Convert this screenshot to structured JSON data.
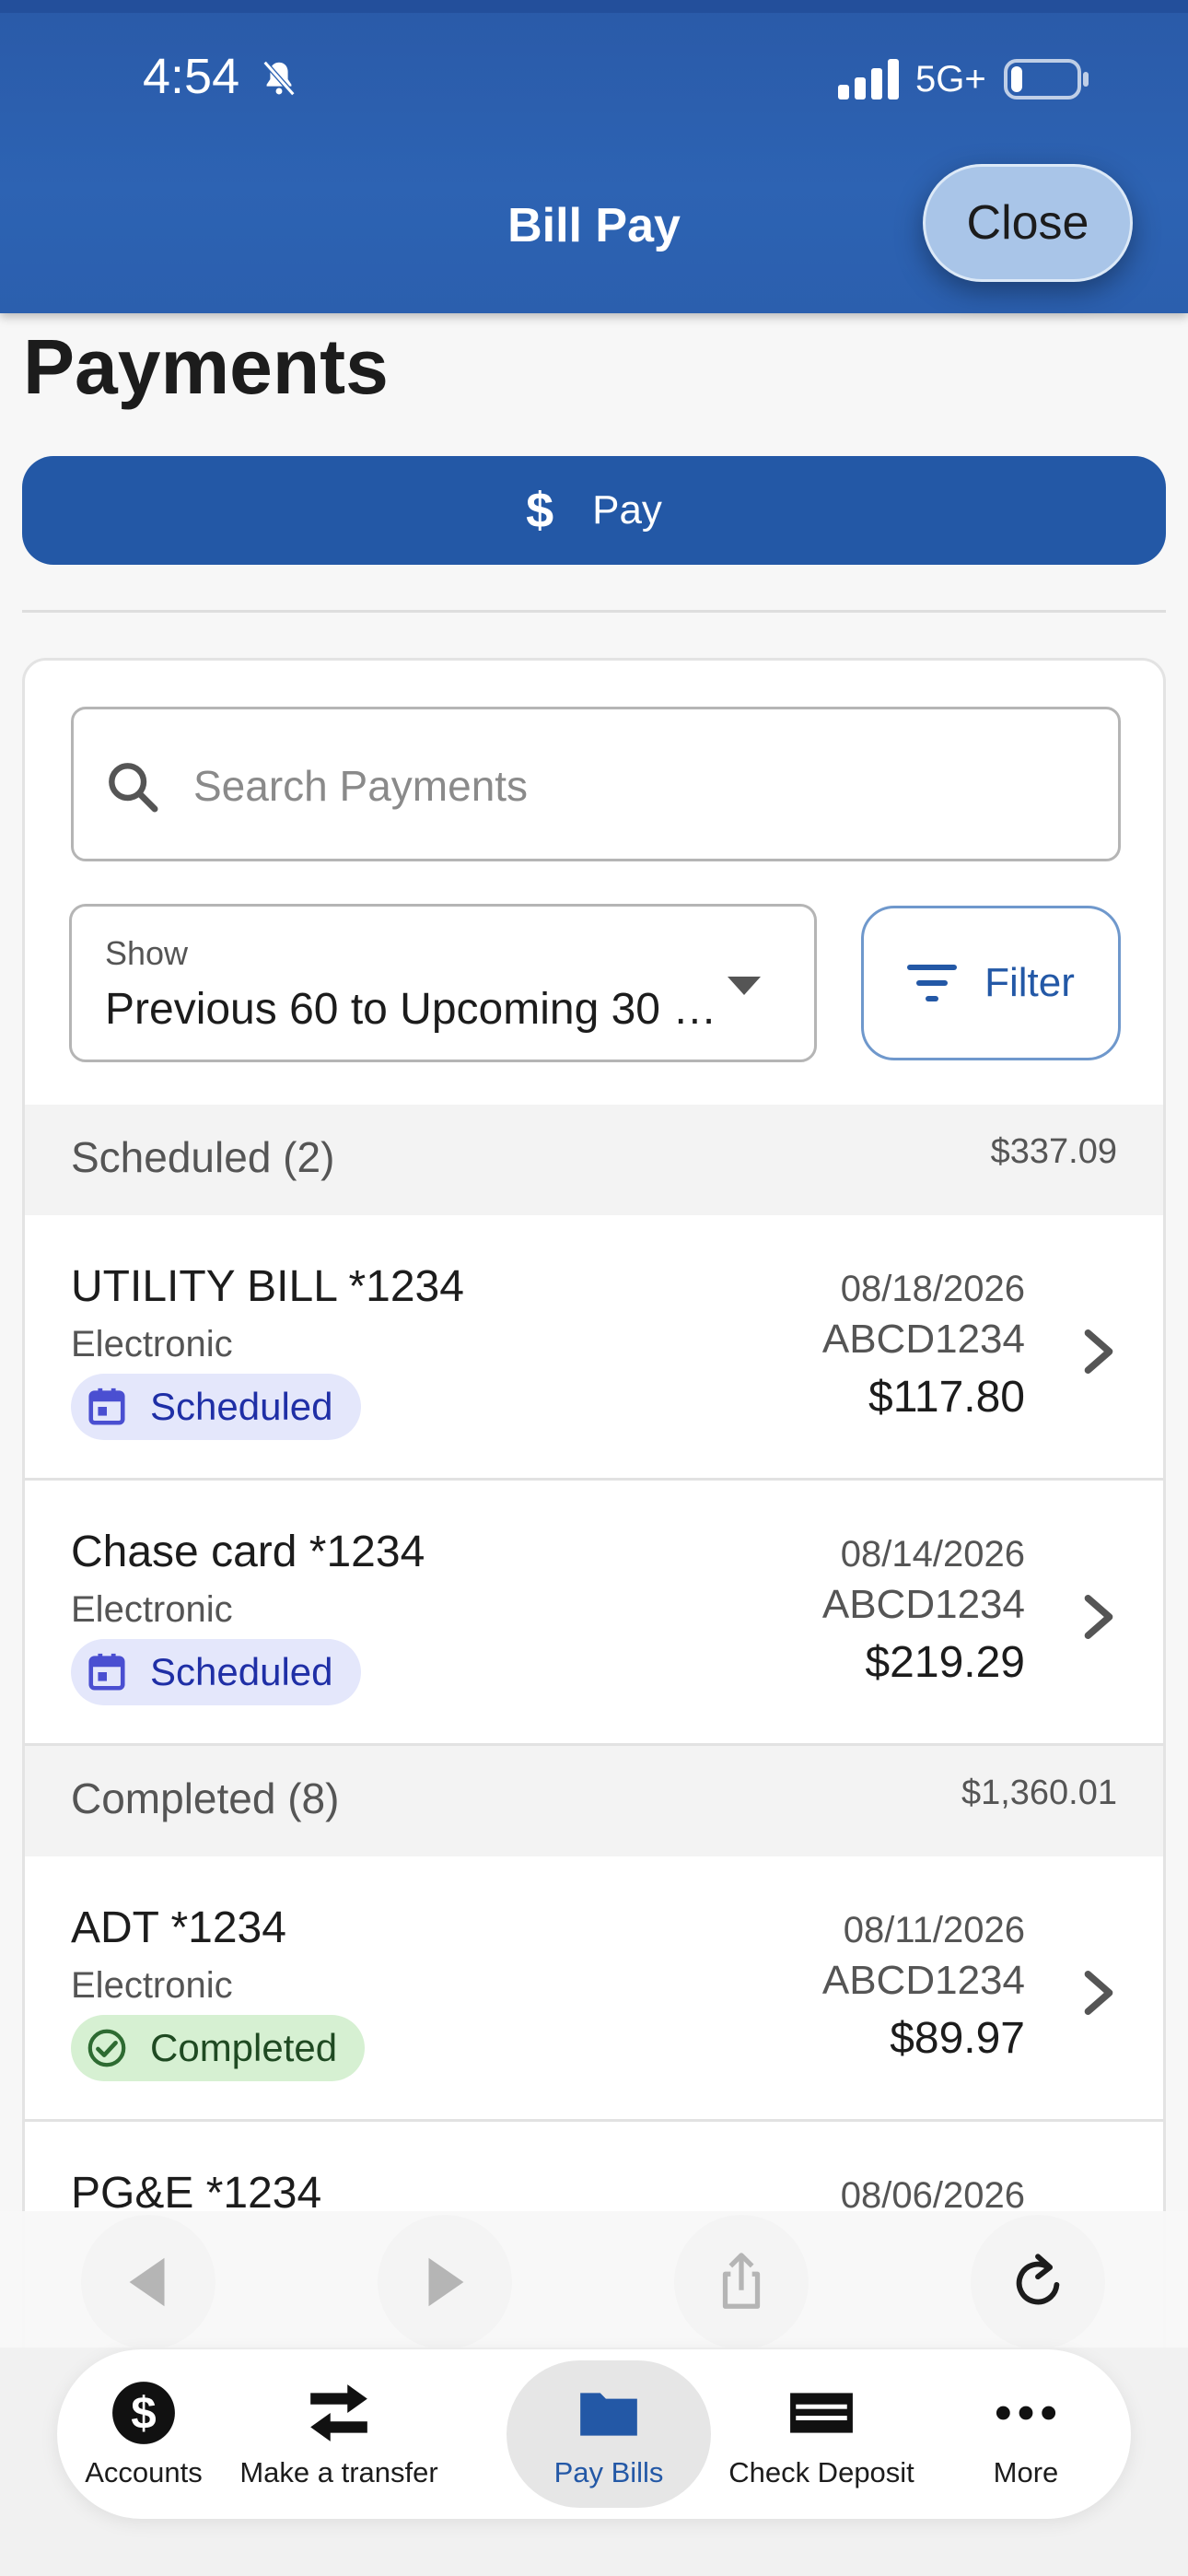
{
  "status_bar": {
    "time": "4:54",
    "network": "5G+"
  },
  "header": {
    "title": "Bill Pay",
    "close_label": "Close"
  },
  "page": {
    "title": "Payments",
    "pay_label": "Pay"
  },
  "search": {
    "placeholder": "Search Payments",
    "value": ""
  },
  "show": {
    "label": "Show",
    "value": "Previous 60 to Upcoming 30 …"
  },
  "filter": {
    "label": "Filter"
  },
  "sections": [
    {
      "title": "Scheduled (2)",
      "total": "$337.09",
      "items": [
        {
          "payee": "UTILITY BILL *1234",
          "method": "Electronic",
          "status": "Scheduled",
          "date": "08/18/2026",
          "ref": "ABCD1234",
          "amount": "$117.80"
        },
        {
          "payee": "Chase card *1234",
          "method": "Electronic",
          "status": "Scheduled",
          "date": "08/14/2026",
          "ref": "ABCD1234",
          "amount": "$219.29"
        }
      ]
    },
    {
      "title": "Completed (8)",
      "total": "$1,360.01",
      "items": [
        {
          "payee": "ADT *1234",
          "method": "Electronic",
          "status": "Completed",
          "date": "08/11/2026",
          "ref": "ABCD1234",
          "amount": "$89.97"
        },
        {
          "payee": "PG&E *1234",
          "date": "08/06/2026"
        }
      ]
    }
  ],
  "tabs": [
    {
      "label": "Accounts",
      "icon": "dollar-circle-icon"
    },
    {
      "label": "Make a transfer",
      "icon": "transfer-arrows-icon"
    },
    {
      "label": "Pay Bills",
      "icon": "folder-icon",
      "active": true
    },
    {
      "label": "Check Deposit",
      "icon": "check-icon"
    },
    {
      "label": "More",
      "icon": "more-dots-icon"
    }
  ],
  "colors": {
    "brand": "#2358a6",
    "header": "#2d63b3",
    "scheduled_badge": "#e4e7fb",
    "completed_badge": "#d6f0d2"
  }
}
